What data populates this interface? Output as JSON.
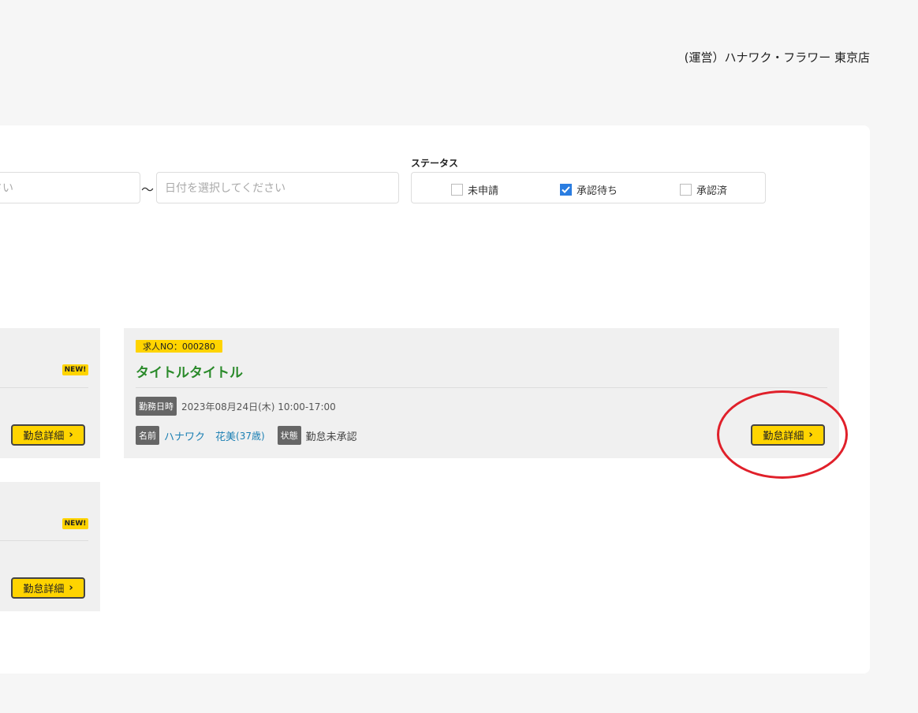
{
  "header": {
    "company": "(運営）ハナワク・フラワー 東京店"
  },
  "filters": {
    "date_from_placeholder": "ださい",
    "tilde": "〜",
    "date_to_placeholder": "日付を選択してください",
    "status_label": "ステータス",
    "status_options": [
      {
        "label": "未申請",
        "checked": false
      },
      {
        "label": "承認待ち",
        "checked": true
      },
      {
        "label": "承認済",
        "checked": false
      }
    ]
  },
  "cards": {
    "left1": {
      "new": "NEW!",
      "button": "勤怠詳細"
    },
    "left2": {
      "new": "NEW!",
      "button": "勤怠詳細"
    },
    "main": {
      "job_no": "求人NO：000280",
      "title": "タイトルタイトル",
      "datetime_tag": "勤務日時",
      "datetime": "2023年08月24日(木) 10:00-17:00",
      "name_tag": "名前",
      "name": "ハナワク　花美",
      "age": "(37歳)",
      "status_tag": "状態",
      "status": "勤怠未承認",
      "button": "勤怠詳細"
    }
  },
  "colors": {
    "accent": "#ffd400",
    "title_green": "#2a8a2a",
    "link_blue": "#1b7fb3",
    "annotation_red": "#e0202a"
  }
}
